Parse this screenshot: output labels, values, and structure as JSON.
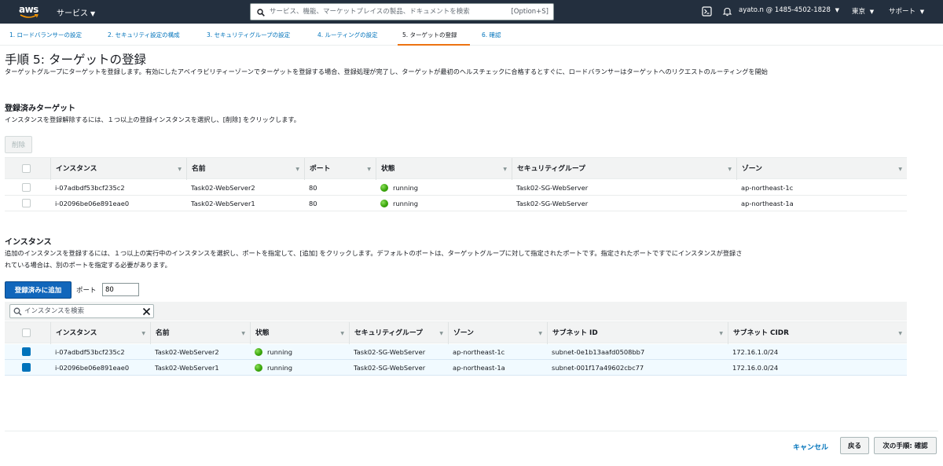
{
  "topnav": {
    "logo_text": "aws",
    "services_label": "サービス",
    "search_placeholder": "サービス、機能、マーケットプレイスの製品、ドキュメントを検索",
    "search_shortcut": "[Option+S]",
    "account": "ayato.n @ 1485-4502-1828",
    "region": "東京",
    "support": "サポート"
  },
  "steps": [
    {
      "label": "1. ロードバランサーの設定"
    },
    {
      "label": "2. セキュリティ設定の構成"
    },
    {
      "label": "3. セキュリティグループの設定"
    },
    {
      "label": "4. ルーティングの設定"
    },
    {
      "label": "5. ターゲットの登録"
    },
    {
      "label": "6. 確認"
    }
  ],
  "page": {
    "title": "手順 5: ターゲットの登録",
    "description": "ターゲットグループにターゲットを登録します。有効にしたアベイラビリティーゾーンでターゲットを登録する場合、登録処理が完了し、ターゲットが最初のヘルスチェックに合格するとすぐに、ロードバランサーはターゲットへのリクエストのルーティングを開始"
  },
  "registered": {
    "title": "登録済みターゲット",
    "description": "インスタンスを登録解除するには、１つ以上の登録インスタンスを選択し、[削除] をクリックします。",
    "delete_label": "削除",
    "columns": [
      "インスタンス",
      "名前",
      "ポート",
      "状態",
      "セキュリティグループ",
      "ゾーン"
    ],
    "rows": [
      {
        "instance": "i-07adbdf53bcf235c2",
        "name": "Task02-WebServer2",
        "port": "80",
        "state": "running",
        "sg": "Task02-SG-WebServer",
        "zone": "ap-northeast-1c"
      },
      {
        "instance": "i-02096be06e891eae0",
        "name": "Task02-WebServer1",
        "port": "80",
        "state": "running",
        "sg": "Task02-SG-WebServer",
        "zone": "ap-northeast-1a"
      }
    ]
  },
  "instances": {
    "title": "インスタンス",
    "description_line1": "追加のインスタンスを登録するには、１つ以上の実行中のインスタンスを選択し、ポートを指定して、[追加] をクリックします。デフォルトのポートは、ターゲットグループに対して指定されたポートです。指定されたポートですでにインスタンスが登録さ",
    "description_line2": "れている場合は、別のポートを指定する必要があります。",
    "add_label": "登録済みに追加",
    "port_label": "ポート",
    "port_value": "80",
    "filter_placeholder": "インスタンスを検索",
    "columns": [
      "インスタンス",
      "名前",
      "状態",
      "セキュリティグループ",
      "ゾーン",
      "サブネット ID",
      "サブネット CIDR"
    ],
    "rows": [
      {
        "instance": "i-07adbdf53bcf235c2",
        "name": "Task02-WebServer2",
        "state": "running",
        "sg": "Task02-SG-WebServer",
        "zone": "ap-northeast-1c",
        "subnet": "subnet-0e1b13aafd0508bb7",
        "cidr": "172.16.1.0/24"
      },
      {
        "instance": "i-02096be06e891eae0",
        "name": "Task02-WebServer1",
        "state": "running",
        "sg": "Task02-SG-WebServer",
        "zone": "ap-northeast-1a",
        "subnet": "subnet-001f17a49602cbc77",
        "cidr": "172.16.0.0/24"
      }
    ]
  },
  "footer": {
    "cancel_label": "キャンセル",
    "back_label": "戻る",
    "next_label": "次の手順: 確認"
  }
}
